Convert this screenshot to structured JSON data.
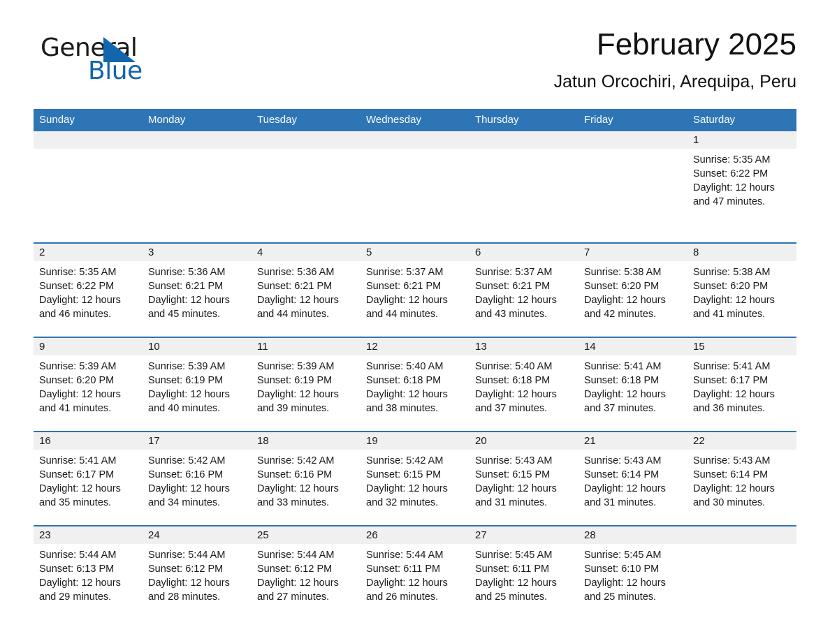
{
  "brand": {
    "name_part1": "General",
    "name_part2": "Blue",
    "logo_icon": "triangle-logo-icon",
    "accent_color": "#1266ad"
  },
  "header": {
    "title": "February 2025",
    "subtitle": "Jatun Orcochiri, Arequipa, Peru"
  },
  "calendar": {
    "header_bg": "#2e75b6",
    "day_band_bg": "#f0f0f0",
    "weekdays": [
      "Sunday",
      "Monday",
      "Tuesday",
      "Wednesday",
      "Thursday",
      "Friday",
      "Saturday"
    ],
    "weeks": [
      {
        "days": [
          {
            "num": "",
            "sunrise": "",
            "sunset": "",
            "daylight_line1": "",
            "daylight_line2": ""
          },
          {
            "num": "",
            "sunrise": "",
            "sunset": "",
            "daylight_line1": "",
            "daylight_line2": ""
          },
          {
            "num": "",
            "sunrise": "",
            "sunset": "",
            "daylight_line1": "",
            "daylight_line2": ""
          },
          {
            "num": "",
            "sunrise": "",
            "sunset": "",
            "daylight_line1": "",
            "daylight_line2": ""
          },
          {
            "num": "",
            "sunrise": "",
            "sunset": "",
            "daylight_line1": "",
            "daylight_line2": ""
          },
          {
            "num": "",
            "sunrise": "",
            "sunset": "",
            "daylight_line1": "",
            "daylight_line2": ""
          },
          {
            "num": "1",
            "sunrise": "Sunrise: 5:35 AM",
            "sunset": "Sunset: 6:22 PM",
            "daylight_line1": "Daylight: 12 hours",
            "daylight_line2": "and 47 minutes."
          }
        ]
      },
      {
        "days": [
          {
            "num": "2",
            "sunrise": "Sunrise: 5:35 AM",
            "sunset": "Sunset: 6:22 PM",
            "daylight_line1": "Daylight: 12 hours",
            "daylight_line2": "and 46 minutes."
          },
          {
            "num": "3",
            "sunrise": "Sunrise: 5:36 AM",
            "sunset": "Sunset: 6:21 PM",
            "daylight_line1": "Daylight: 12 hours",
            "daylight_line2": "and 45 minutes."
          },
          {
            "num": "4",
            "sunrise": "Sunrise: 5:36 AM",
            "sunset": "Sunset: 6:21 PM",
            "daylight_line1": "Daylight: 12 hours",
            "daylight_line2": "and 44 minutes."
          },
          {
            "num": "5",
            "sunrise": "Sunrise: 5:37 AM",
            "sunset": "Sunset: 6:21 PM",
            "daylight_line1": "Daylight: 12 hours",
            "daylight_line2": "and 44 minutes."
          },
          {
            "num": "6",
            "sunrise": "Sunrise: 5:37 AM",
            "sunset": "Sunset: 6:21 PM",
            "daylight_line1": "Daylight: 12 hours",
            "daylight_line2": "and 43 minutes."
          },
          {
            "num": "7",
            "sunrise": "Sunrise: 5:38 AM",
            "sunset": "Sunset: 6:20 PM",
            "daylight_line1": "Daylight: 12 hours",
            "daylight_line2": "and 42 minutes."
          },
          {
            "num": "8",
            "sunrise": "Sunrise: 5:38 AM",
            "sunset": "Sunset: 6:20 PM",
            "daylight_line1": "Daylight: 12 hours",
            "daylight_line2": "and 41 minutes."
          }
        ]
      },
      {
        "days": [
          {
            "num": "9",
            "sunrise": "Sunrise: 5:39 AM",
            "sunset": "Sunset: 6:20 PM",
            "daylight_line1": "Daylight: 12 hours",
            "daylight_line2": "and 41 minutes."
          },
          {
            "num": "10",
            "sunrise": "Sunrise: 5:39 AM",
            "sunset": "Sunset: 6:19 PM",
            "daylight_line1": "Daylight: 12 hours",
            "daylight_line2": "and 40 minutes."
          },
          {
            "num": "11",
            "sunrise": "Sunrise: 5:39 AM",
            "sunset": "Sunset: 6:19 PM",
            "daylight_line1": "Daylight: 12 hours",
            "daylight_line2": "and 39 minutes."
          },
          {
            "num": "12",
            "sunrise": "Sunrise: 5:40 AM",
            "sunset": "Sunset: 6:18 PM",
            "daylight_line1": "Daylight: 12 hours",
            "daylight_line2": "and 38 minutes."
          },
          {
            "num": "13",
            "sunrise": "Sunrise: 5:40 AM",
            "sunset": "Sunset: 6:18 PM",
            "daylight_line1": "Daylight: 12 hours",
            "daylight_line2": "and 37 minutes."
          },
          {
            "num": "14",
            "sunrise": "Sunrise: 5:41 AM",
            "sunset": "Sunset: 6:18 PM",
            "daylight_line1": "Daylight: 12 hours",
            "daylight_line2": "and 37 minutes."
          },
          {
            "num": "15",
            "sunrise": "Sunrise: 5:41 AM",
            "sunset": "Sunset: 6:17 PM",
            "daylight_line1": "Daylight: 12 hours",
            "daylight_line2": "and 36 minutes."
          }
        ]
      },
      {
        "days": [
          {
            "num": "16",
            "sunrise": "Sunrise: 5:41 AM",
            "sunset": "Sunset: 6:17 PM",
            "daylight_line1": "Daylight: 12 hours",
            "daylight_line2": "and 35 minutes."
          },
          {
            "num": "17",
            "sunrise": "Sunrise: 5:42 AM",
            "sunset": "Sunset: 6:16 PM",
            "daylight_line1": "Daylight: 12 hours",
            "daylight_line2": "and 34 minutes."
          },
          {
            "num": "18",
            "sunrise": "Sunrise: 5:42 AM",
            "sunset": "Sunset: 6:16 PM",
            "daylight_line1": "Daylight: 12 hours",
            "daylight_line2": "and 33 minutes."
          },
          {
            "num": "19",
            "sunrise": "Sunrise: 5:42 AM",
            "sunset": "Sunset: 6:15 PM",
            "daylight_line1": "Daylight: 12 hours",
            "daylight_line2": "and 32 minutes."
          },
          {
            "num": "20",
            "sunrise": "Sunrise: 5:43 AM",
            "sunset": "Sunset: 6:15 PM",
            "daylight_line1": "Daylight: 12 hours",
            "daylight_line2": "and 31 minutes."
          },
          {
            "num": "21",
            "sunrise": "Sunrise: 5:43 AM",
            "sunset": "Sunset: 6:14 PM",
            "daylight_line1": "Daylight: 12 hours",
            "daylight_line2": "and 31 minutes."
          },
          {
            "num": "22",
            "sunrise": "Sunrise: 5:43 AM",
            "sunset": "Sunset: 6:14 PM",
            "daylight_line1": "Daylight: 12 hours",
            "daylight_line2": "and 30 minutes."
          }
        ]
      },
      {
        "days": [
          {
            "num": "23",
            "sunrise": "Sunrise: 5:44 AM",
            "sunset": "Sunset: 6:13 PM",
            "daylight_line1": "Daylight: 12 hours",
            "daylight_line2": "and 29 minutes."
          },
          {
            "num": "24",
            "sunrise": "Sunrise: 5:44 AM",
            "sunset": "Sunset: 6:12 PM",
            "daylight_line1": "Daylight: 12 hours",
            "daylight_line2": "and 28 minutes."
          },
          {
            "num": "25",
            "sunrise": "Sunrise: 5:44 AM",
            "sunset": "Sunset: 6:12 PM",
            "daylight_line1": "Daylight: 12 hours",
            "daylight_line2": "and 27 minutes."
          },
          {
            "num": "26",
            "sunrise": "Sunrise: 5:44 AM",
            "sunset": "Sunset: 6:11 PM",
            "daylight_line1": "Daylight: 12 hours",
            "daylight_line2": "and 26 minutes."
          },
          {
            "num": "27",
            "sunrise": "Sunrise: 5:45 AM",
            "sunset": "Sunset: 6:11 PM",
            "daylight_line1": "Daylight: 12 hours",
            "daylight_line2": "and 25 minutes."
          },
          {
            "num": "28",
            "sunrise": "Sunrise: 5:45 AM",
            "sunset": "Sunset: 6:10 PM",
            "daylight_line1": "Daylight: 12 hours",
            "daylight_line2": "and 25 minutes."
          },
          {
            "num": "",
            "sunrise": "",
            "sunset": "",
            "daylight_line1": "",
            "daylight_line2": ""
          }
        ]
      }
    ]
  }
}
